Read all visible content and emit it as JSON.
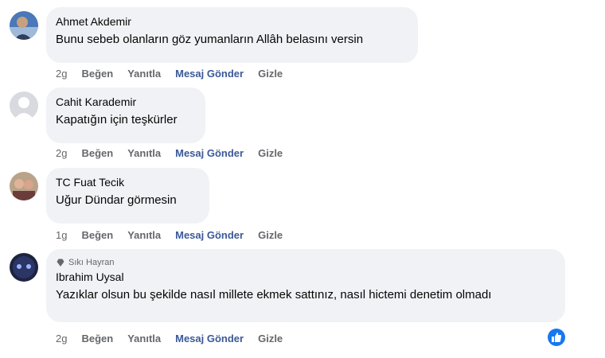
{
  "comments": [
    {
      "name": "Ahmet Akdemir",
      "text": "Bunu sebeb olanların göz yumanların Allâh belasını versin",
      "time": "2g"
    },
    {
      "name": "Cahit Karademir",
      "text": "Kapatığın için teşkürler",
      "time": "2g"
    },
    {
      "name": "TC Fuat Tecik",
      "text": "Uğur Dündar görmesin",
      "time": "1g"
    },
    {
      "badge": "Sıkı Hayran",
      "name": "Ibrahim Uysal",
      "text": "Yazıklar olsun bu şekilde nasıl millete ekmek sattınız, nasıl hictemi denetim olmadı",
      "time": "2g"
    }
  ],
  "actions": {
    "like": "Beğen",
    "reply": "Yanıtla",
    "message": "Mesaj Gönder",
    "hide": "Gizle"
  },
  "colors": {
    "bubble": "#f0f2f5",
    "action_text": "#65676b",
    "message_link": "#3b5998",
    "like_blue": "#1877f2"
  },
  "icons": [
    "avatar-photo",
    "default-avatar-icon",
    "fan-badge-icon",
    "like-reaction-icon"
  ]
}
